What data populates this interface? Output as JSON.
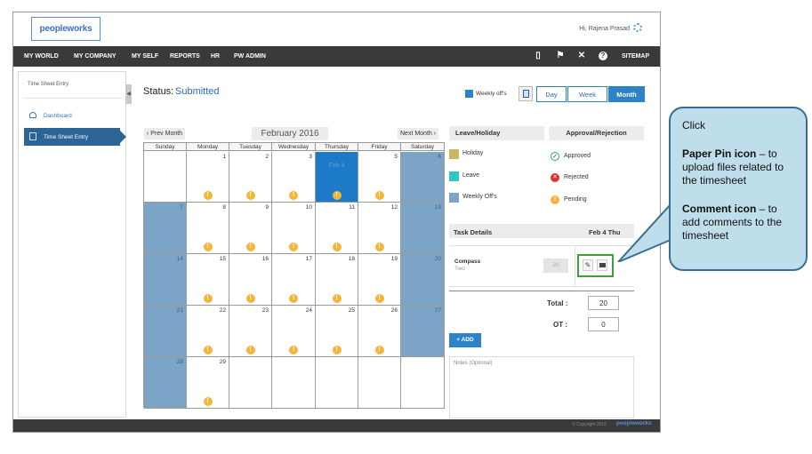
{
  "header": {
    "logo_text": "peopleworks",
    "greeting": "Hi, Rajena Prasad"
  },
  "nav": {
    "items": [
      "MY WORLD",
      "MY COMPANY",
      "MY SELF",
      "REPORTS",
      "HR",
      "PW ADMIN"
    ],
    "sitemap": "SITEMAP"
  },
  "sidebar": {
    "title": "Time Sheet Entry",
    "items": [
      "Dashboard",
      "Time Sheet Entry"
    ]
  },
  "status": {
    "label": "Status:",
    "value": "Submitted"
  },
  "view": {
    "weekly_offs": "Weekly off's",
    "buttons": [
      "Day",
      "Week",
      "Month"
    ],
    "selected": "Month"
  },
  "calendar": {
    "prev": "Prev Month",
    "next": "Next Month",
    "title": "February 2016",
    "days_of_week": [
      "Sunday",
      "Monday",
      "Tuesday",
      "Wednesday",
      "Thursday",
      "Friday",
      "Saturday"
    ],
    "today_text": "Feb 4",
    "weeks": [
      [
        null,
        1,
        2,
        3,
        4,
        5,
        6
      ],
      [
        7,
        8,
        9,
        10,
        11,
        12,
        13
      ],
      [
        14,
        15,
        16,
        17,
        18,
        19,
        20
      ],
      [
        21,
        22,
        23,
        24,
        25,
        26,
        27
      ],
      [
        28,
        29,
        null,
        null,
        null,
        null,
        null
      ]
    ],
    "today": 4
  },
  "legend": {
    "title": "Leave/Holiday",
    "items": [
      {
        "label": "Holiday",
        "color": "#c9b95a"
      },
      {
        "label": "Leave",
        "color": "#2ec8c8"
      },
      {
        "label": "Weekly Off's",
        "color": "#7ba4c7"
      }
    ]
  },
  "approval": {
    "title": "Approval/Rejection",
    "items": [
      {
        "label": "Approved",
        "color": "#3aa046"
      },
      {
        "label": "Rejected",
        "color": "#e0332a"
      },
      {
        "label": "Pending",
        "color": "#f4b63a"
      }
    ]
  },
  "task": {
    "title": "Task Details",
    "date": "Feb 4 Thu",
    "name": "Compass",
    "sub": "Two",
    "hours": "20"
  },
  "totals": {
    "total_label": "Total :",
    "total_value": "20",
    "ot_label": "OT :",
    "ot_value": "0"
  },
  "add_label": "+ ADD",
  "notes_placeholder": "Notes (Optional)",
  "footer": {
    "copyright": "© Copyright 2016",
    "brand": "peopleworks"
  },
  "callout": {
    "click": "Click",
    "pin_bold": "Paper Pin icon",
    "pin_rest": " – to upload files related to the timesheet",
    "comment_bold": "Comment icon",
    "comment_rest": " – to add comments to the timesheet"
  }
}
